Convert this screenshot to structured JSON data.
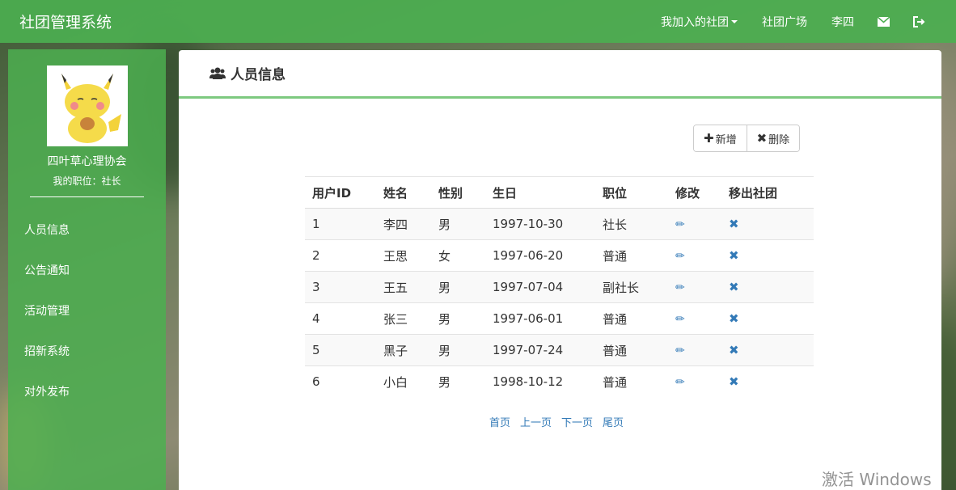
{
  "navbar": {
    "brand": "社团管理系统",
    "my_clubs": "我加入的社团",
    "club_square": "社团广场",
    "user": "李四"
  },
  "sidebar": {
    "club_name": "四叶草心理协会",
    "position": "我的职位：社长",
    "items": [
      {
        "label": "人员信息"
      },
      {
        "label": "公告通知"
      },
      {
        "label": "活动管理"
      },
      {
        "label": "招新系统"
      },
      {
        "label": "对外发布"
      }
    ]
  },
  "panel": {
    "title": "人员信息",
    "add_label": "新增",
    "delete_label": "删除"
  },
  "table": {
    "headers": [
      "用户ID",
      "姓名",
      "性别",
      "生日",
      "职位",
      "修改",
      "移出社团"
    ],
    "rows": [
      {
        "id": "1",
        "name": "李四",
        "gender": "男",
        "birthday": "1997-10-30",
        "role": "社长"
      },
      {
        "id": "2",
        "name": "王思",
        "gender": "女",
        "birthday": "1997-06-20",
        "role": "普通"
      },
      {
        "id": "3",
        "name": "王五",
        "gender": "男",
        "birthday": "1997-07-04",
        "role": "副社长"
      },
      {
        "id": "4",
        "name": "张三",
        "gender": "男",
        "birthday": "1997-06-01",
        "role": "普通"
      },
      {
        "id": "5",
        "name": "黑子",
        "gender": "男",
        "birthday": "1997-07-24",
        "role": "普通"
      },
      {
        "id": "6",
        "name": "小白",
        "gender": "男",
        "birthday": "1998-10-12",
        "role": "普通"
      }
    ]
  },
  "pager": {
    "first": "首页",
    "prev": "上一页",
    "next": "下一页",
    "last": "尾页"
  },
  "watermark": "激活 Windows",
  "colors": {
    "accent": "#4caf50",
    "link": "#337ab7"
  }
}
